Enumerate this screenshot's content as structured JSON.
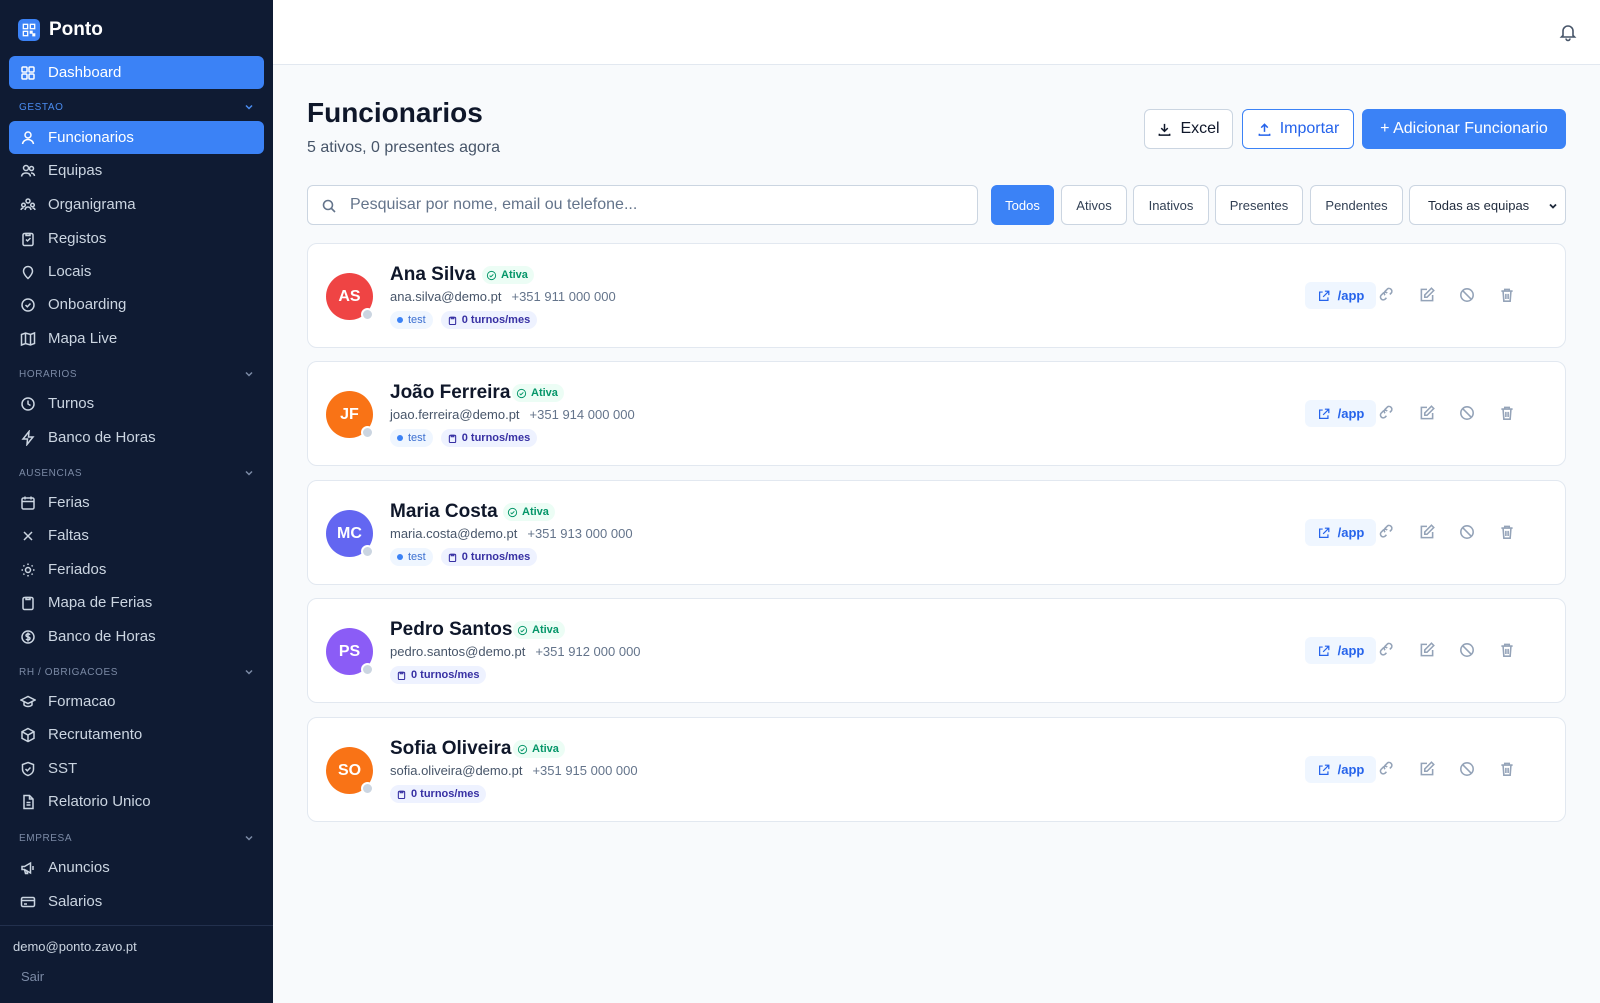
{
  "brand": {
    "name": "Ponto"
  },
  "sidebar": {
    "dashboard": "Dashboard",
    "sections": [
      {
        "title": "GESTAO",
        "items": [
          "Funcionarios",
          "Equipas",
          "Organigrama",
          "Registos",
          "Locais",
          "Onboarding",
          "Mapa Live"
        ]
      },
      {
        "title": "HORARIOS",
        "items": [
          "Turnos",
          "Banco de Horas"
        ]
      },
      {
        "title": "AUSENCIAS",
        "items": [
          "Ferias",
          "Faltas",
          "Feriados",
          "Mapa de Ferias",
          "Banco de Horas"
        ]
      },
      {
        "title": "RH / OBRIGACOES",
        "items": [
          "Formacao",
          "Recrutamento",
          "SST",
          "Relatorio Unico"
        ]
      },
      {
        "title": "EMPRESA",
        "items": [
          "Anuncios",
          "Salarios"
        ]
      }
    ],
    "user_email": "demo@ponto.zavo.pt",
    "logout": "Sair"
  },
  "header": {
    "title": "Funcionarios",
    "subtitle": "5 ativos, 0 presentes agora",
    "excel": "Excel",
    "import": "Importar",
    "add": "+ Adicionar Funcionario"
  },
  "filters": {
    "search_placeholder": "Pesquisar por nome, email ou telefone...",
    "search_value": "",
    "buttons": [
      "Todos",
      "Ativos",
      "Inativos",
      "Presentes",
      "Pendentes"
    ],
    "active": "Todos",
    "team_select": "Todas as equipas"
  },
  "employees": [
    {
      "initials": "AS",
      "name": "Ana Silva",
      "status": "Ativa",
      "email": "ana.silva@demo.pt",
      "phone": "+351 911 000 000",
      "team": "test",
      "shifts": "0 turnos/mes",
      "app": "/app",
      "color": "#ef4444"
    },
    {
      "initials": "JF",
      "name": "João Ferreira",
      "status": "Ativa",
      "email": "joao.ferreira@demo.pt",
      "phone": "+351 914 000 000",
      "team": "test",
      "shifts": "0 turnos/mes",
      "app": "/app",
      "color": "#f97316"
    },
    {
      "initials": "MC",
      "name": "Maria Costa",
      "status": "Ativa",
      "email": "maria.costa@demo.pt",
      "phone": "+351 913 000 000",
      "team": "test",
      "shifts": "0 turnos/mes",
      "app": "/app",
      "color": "#6366f1"
    },
    {
      "initials": "PS",
      "name": "Pedro Santos",
      "status": "Ativa",
      "email": "pedro.santos@demo.pt",
      "phone": "+351 912 000 000",
      "team": "",
      "shifts": "0 turnos/mes",
      "app": "/app",
      "color": "#8b5cf6"
    },
    {
      "initials": "SO",
      "name": "Sofia Oliveira",
      "status": "Ativa",
      "email": "sofia.oliveira@demo.pt",
      "phone": "+351 915 000 000",
      "team": "",
      "shifts": "0 turnos/mes",
      "app": "/app",
      "color": "#f97316"
    }
  ],
  "colors": {
    "sidebar_bg": "#0f1b33",
    "accent": "#3b82f6",
    "active_status": "#059669"
  }
}
